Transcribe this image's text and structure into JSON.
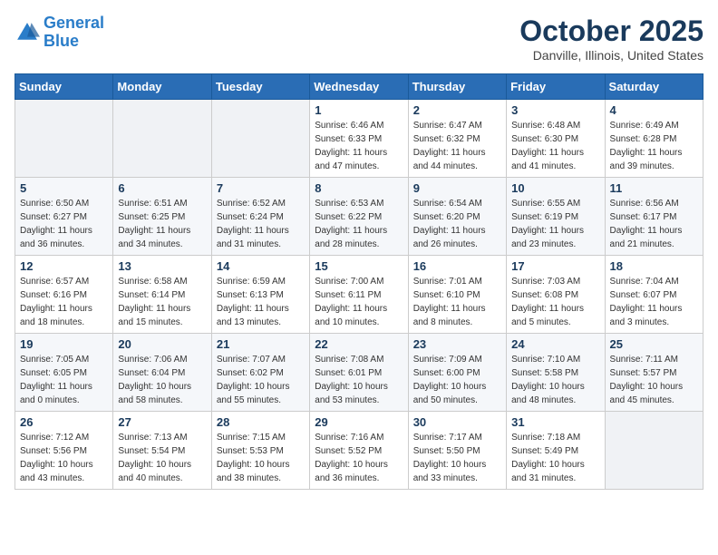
{
  "logo": {
    "line1": "General",
    "line2": "Blue"
  },
  "title": "October 2025",
  "subtitle": "Danville, Illinois, United States",
  "days_of_week": [
    "Sunday",
    "Monday",
    "Tuesday",
    "Wednesday",
    "Thursday",
    "Friday",
    "Saturday"
  ],
  "weeks": [
    [
      {
        "day": "",
        "info": ""
      },
      {
        "day": "",
        "info": ""
      },
      {
        "day": "",
        "info": ""
      },
      {
        "day": "1",
        "info": "Sunrise: 6:46 AM\nSunset: 6:33 PM\nDaylight: 11 hours and 47 minutes."
      },
      {
        "day": "2",
        "info": "Sunrise: 6:47 AM\nSunset: 6:32 PM\nDaylight: 11 hours and 44 minutes."
      },
      {
        "day": "3",
        "info": "Sunrise: 6:48 AM\nSunset: 6:30 PM\nDaylight: 11 hours and 41 minutes."
      },
      {
        "day": "4",
        "info": "Sunrise: 6:49 AM\nSunset: 6:28 PM\nDaylight: 11 hours and 39 minutes."
      }
    ],
    [
      {
        "day": "5",
        "info": "Sunrise: 6:50 AM\nSunset: 6:27 PM\nDaylight: 11 hours and 36 minutes."
      },
      {
        "day": "6",
        "info": "Sunrise: 6:51 AM\nSunset: 6:25 PM\nDaylight: 11 hours and 34 minutes."
      },
      {
        "day": "7",
        "info": "Sunrise: 6:52 AM\nSunset: 6:24 PM\nDaylight: 11 hours and 31 minutes."
      },
      {
        "day": "8",
        "info": "Sunrise: 6:53 AM\nSunset: 6:22 PM\nDaylight: 11 hours and 28 minutes."
      },
      {
        "day": "9",
        "info": "Sunrise: 6:54 AM\nSunset: 6:20 PM\nDaylight: 11 hours and 26 minutes."
      },
      {
        "day": "10",
        "info": "Sunrise: 6:55 AM\nSunset: 6:19 PM\nDaylight: 11 hours and 23 minutes."
      },
      {
        "day": "11",
        "info": "Sunrise: 6:56 AM\nSunset: 6:17 PM\nDaylight: 11 hours and 21 minutes."
      }
    ],
    [
      {
        "day": "12",
        "info": "Sunrise: 6:57 AM\nSunset: 6:16 PM\nDaylight: 11 hours and 18 minutes."
      },
      {
        "day": "13",
        "info": "Sunrise: 6:58 AM\nSunset: 6:14 PM\nDaylight: 11 hours and 15 minutes."
      },
      {
        "day": "14",
        "info": "Sunrise: 6:59 AM\nSunset: 6:13 PM\nDaylight: 11 hours and 13 minutes."
      },
      {
        "day": "15",
        "info": "Sunrise: 7:00 AM\nSunset: 6:11 PM\nDaylight: 11 hours and 10 minutes."
      },
      {
        "day": "16",
        "info": "Sunrise: 7:01 AM\nSunset: 6:10 PM\nDaylight: 11 hours and 8 minutes."
      },
      {
        "day": "17",
        "info": "Sunrise: 7:03 AM\nSunset: 6:08 PM\nDaylight: 11 hours and 5 minutes."
      },
      {
        "day": "18",
        "info": "Sunrise: 7:04 AM\nSunset: 6:07 PM\nDaylight: 11 hours and 3 minutes."
      }
    ],
    [
      {
        "day": "19",
        "info": "Sunrise: 7:05 AM\nSunset: 6:05 PM\nDaylight: 11 hours and 0 minutes."
      },
      {
        "day": "20",
        "info": "Sunrise: 7:06 AM\nSunset: 6:04 PM\nDaylight: 10 hours and 58 minutes."
      },
      {
        "day": "21",
        "info": "Sunrise: 7:07 AM\nSunset: 6:02 PM\nDaylight: 10 hours and 55 minutes."
      },
      {
        "day": "22",
        "info": "Sunrise: 7:08 AM\nSunset: 6:01 PM\nDaylight: 10 hours and 53 minutes."
      },
      {
        "day": "23",
        "info": "Sunrise: 7:09 AM\nSunset: 6:00 PM\nDaylight: 10 hours and 50 minutes."
      },
      {
        "day": "24",
        "info": "Sunrise: 7:10 AM\nSunset: 5:58 PM\nDaylight: 10 hours and 48 minutes."
      },
      {
        "day": "25",
        "info": "Sunrise: 7:11 AM\nSunset: 5:57 PM\nDaylight: 10 hours and 45 minutes."
      }
    ],
    [
      {
        "day": "26",
        "info": "Sunrise: 7:12 AM\nSunset: 5:56 PM\nDaylight: 10 hours and 43 minutes."
      },
      {
        "day": "27",
        "info": "Sunrise: 7:13 AM\nSunset: 5:54 PM\nDaylight: 10 hours and 40 minutes."
      },
      {
        "day": "28",
        "info": "Sunrise: 7:15 AM\nSunset: 5:53 PM\nDaylight: 10 hours and 38 minutes."
      },
      {
        "day": "29",
        "info": "Sunrise: 7:16 AM\nSunset: 5:52 PM\nDaylight: 10 hours and 36 minutes."
      },
      {
        "day": "30",
        "info": "Sunrise: 7:17 AM\nSunset: 5:50 PM\nDaylight: 10 hours and 33 minutes."
      },
      {
        "day": "31",
        "info": "Sunrise: 7:18 AM\nSunset: 5:49 PM\nDaylight: 10 hours and 31 minutes."
      },
      {
        "day": "",
        "info": ""
      }
    ]
  ]
}
